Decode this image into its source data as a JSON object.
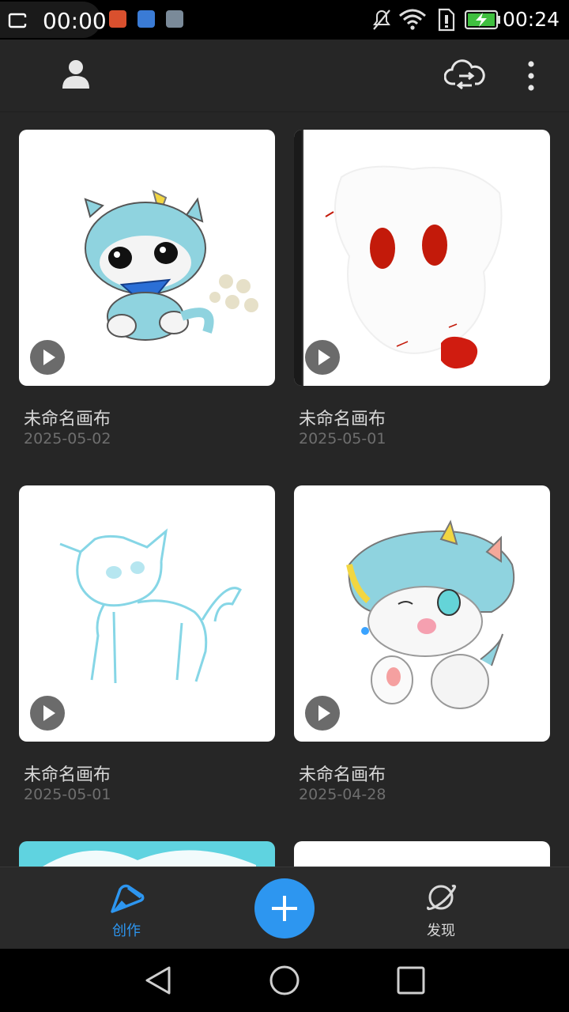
{
  "status_bar": {
    "recording_time": "00:00",
    "clock": "00:24"
  },
  "app_bar": {
    "icons": [
      "user-icon",
      "cloud-sync-icon",
      "more-vert-icon"
    ]
  },
  "canvases": [
    {
      "name": "未命名画布",
      "date": "2025-05-02",
      "thumbnail": "blue-cat-drawing"
    },
    {
      "name": "未命名画布",
      "date": "2025-05-01",
      "thumbnail": "white-ghost-drawing"
    },
    {
      "name": "未命名画布",
      "date": "2025-05-01",
      "thumbnail": "cyan-line-cat-drawing"
    },
    {
      "name": "未命名画布",
      "date": "2025-04-28",
      "thumbnail": "cat-with-hat-drawing"
    }
  ],
  "bottom_nav": {
    "create_label": "创作",
    "discover_label": "发现"
  },
  "colors": {
    "accent": "#2d96f0",
    "background": "#262626"
  }
}
